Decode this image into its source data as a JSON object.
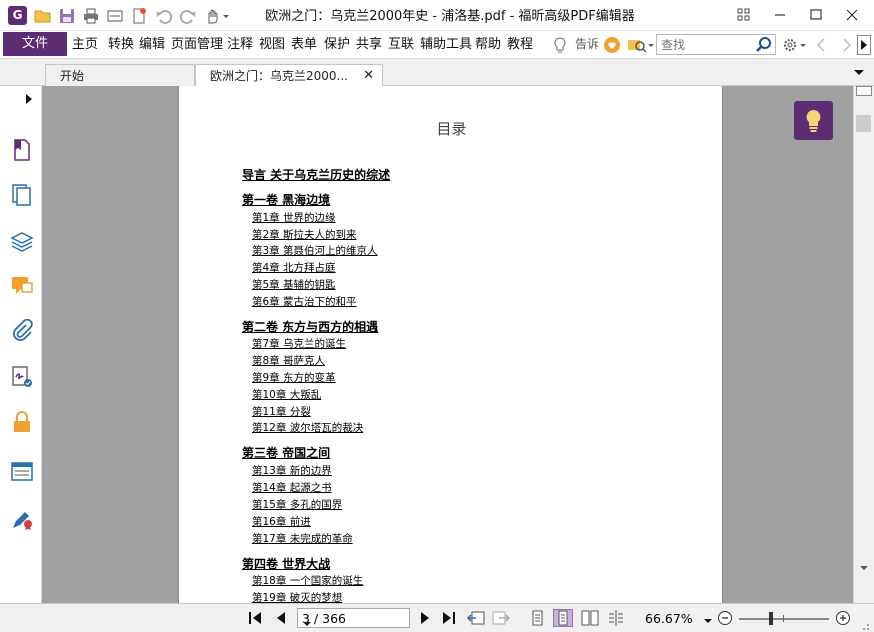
{
  "window": {
    "title": "欧洲之门：乌克兰2000年史 - 浦洛基.pdf - 福昕高级PDF编辑器",
    "logo_letter": "G"
  },
  "menu": {
    "file": "文件",
    "items": [
      "主页",
      "转换",
      "编辑",
      "页面管理",
      "注释",
      "视图",
      "表单",
      "保护",
      "共享",
      "互联",
      "辅助工具",
      "帮助",
      "教程"
    ],
    "tell_me": "告诉",
    "search_placeholder": "查找"
  },
  "tabs": [
    {
      "label": "开始",
      "active": false
    },
    {
      "label": "欧洲之门：乌克兰2000...",
      "active": true
    }
  ],
  "document": {
    "toc_title": "目录",
    "sections": [
      {
        "title": "导言 关于乌克兰历史的综述",
        "chapters": []
      },
      {
        "title": "第一卷 黑海边境",
        "chapters": [
          "第1章 世界的边缘",
          "第2章 斯拉夫人的到来",
          "第3章 第聂伯河上的维京人",
          "第4章 北方拜占庭",
          "第5章 基辅的钥匙",
          "第6章 蒙古治下的和平"
        ]
      },
      {
        "title": "第二卷 东方与西方的相遇",
        "chapters": [
          "第7章 乌克兰的诞生",
          "第8章 哥萨克人",
          "第9章 东方的变革",
          "第10章 大叛乱",
          "第11章 分裂",
          "第12章 波尔塔瓦的裁决"
        ]
      },
      {
        "title": "第三卷 帝国之间",
        "chapters": [
          "第13章 新的边界",
          "第14章 起源之书",
          "第15章 多孔的国界",
          "第16章 前进",
          "第17章 未完成的革命"
        ]
      },
      {
        "title": "第四卷 世界大战",
        "chapters": [
          "第18章 一个国家的诞生",
          "第19章 破灭的梦想"
        ]
      }
    ]
  },
  "statusbar": {
    "page_display": "3 / 366",
    "current_page": 3,
    "total_pages": 366,
    "zoom": "66.67%"
  },
  "colors": {
    "accent": "#5c2d73",
    "doc_background": "#a0a0a0"
  }
}
